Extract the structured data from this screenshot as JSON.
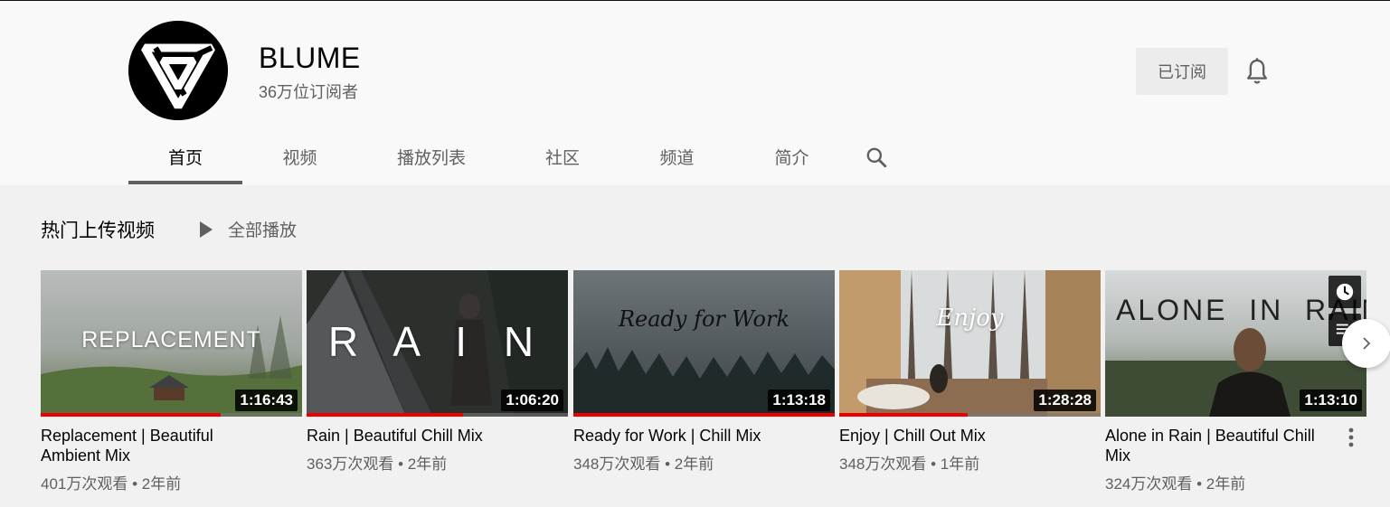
{
  "channel": {
    "name": "BLUME",
    "subscribers": "36万位订阅者",
    "subscribed_label": "已订阅"
  },
  "tabs": [
    {
      "label": "首页",
      "active": true
    },
    {
      "label": "视频"
    },
    {
      "label": "播放列表"
    },
    {
      "label": "社区"
    },
    {
      "label": "频道"
    },
    {
      "label": "简介"
    }
  ],
  "section": {
    "title": "热门上传视频",
    "play_all_label": "全部播放"
  },
  "videos": [
    {
      "title": "Replacement | Beautiful Ambient Mix",
      "thumb_text": "REPLACEMENT",
      "duration": "1:16:43",
      "views": "401万次观看",
      "age": "2年前",
      "progress": 0.69
    },
    {
      "title": "Rain | Beautiful Chill Mix",
      "thumb_text": "R A I N",
      "duration": "1:06:20",
      "views": "363万次观看",
      "age": "2年前",
      "progress": 0.6
    },
    {
      "title": "Ready for Work | Chill Mix",
      "thumb_text": "Ready for Work",
      "duration": "1:13:18",
      "views": "348万次观看",
      "age": "2年前",
      "progress": 1.0
    },
    {
      "title": "Enjoy | Chill Out Mix",
      "thumb_text": "Enjoy",
      "duration": "1:28:28",
      "views": "348万次观看",
      "age": "1年前",
      "progress": 0.49
    },
    {
      "title": "Alone in Rain | Beautiful Chill Mix",
      "thumb_text": "ALONE  IN  RAIN",
      "duration": "1:13:10",
      "views": "324万次观看",
      "age": "2年前",
      "progress": 0
    }
  ],
  "meta_separator": "•",
  "icons": {
    "bell": "bell-icon",
    "search": "search-icon",
    "play": "play-icon",
    "watch_later": "clock-icon",
    "add_to_queue": "queue-icon",
    "next": "chevron-right-icon",
    "more": "more-vert-icon"
  }
}
